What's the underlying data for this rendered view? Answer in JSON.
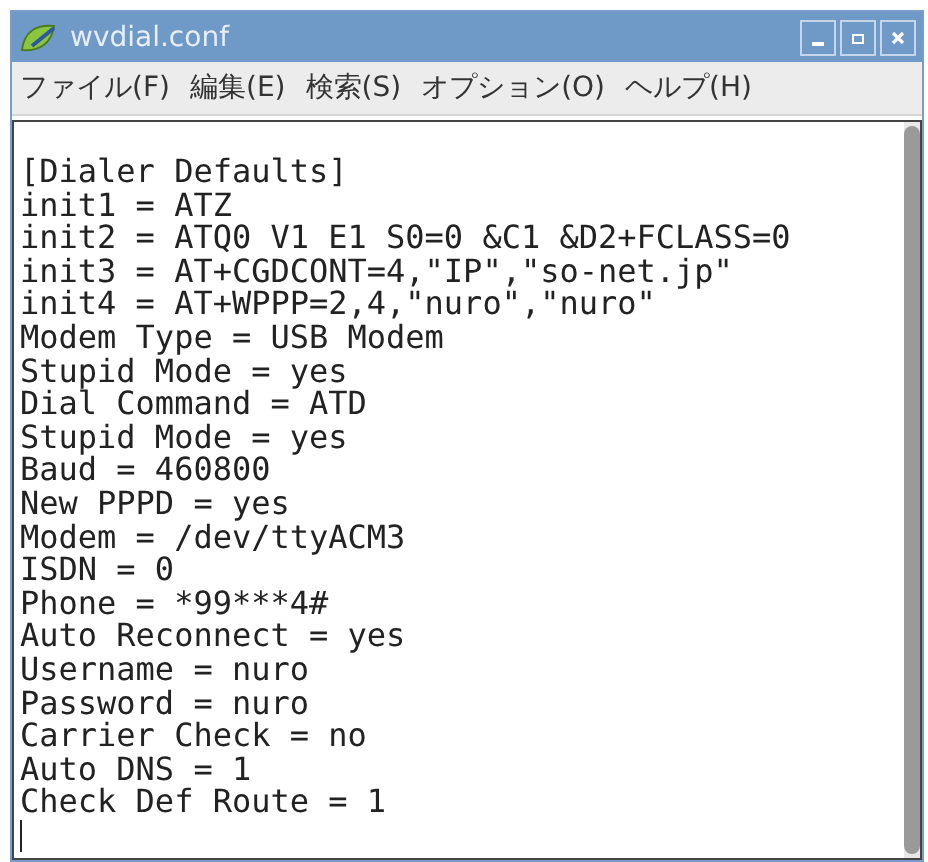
{
  "window": {
    "title": "wvdial.conf"
  },
  "menu": [
    "ファイル(F)",
    "編集(E)",
    "検索(S)",
    "オプション(O)",
    "ヘルプ(H)"
  ],
  "editor": {
    "lines": [
      "[Dialer Defaults]",
      "init1 = ATZ",
      "init2 = ATQ0 V1 E1 S0=0 &C1 &D2+FCLASS=0",
      "init3 = AT+CGDCONT=4,\"IP\",\"so-net.jp\"",
      "init4 = AT+WPPP=2,4,\"nuro\",\"nuro\"",
      "Modem Type = USB Modem",
      "Stupid Mode = yes",
      "Dial Command = ATD",
      "Stupid Mode = yes",
      "Baud = 460800",
      "New PPPD = yes",
      "Modem = /dev/ttyACM3",
      "ISDN = 0",
      "Phone = *99***4#",
      "Auto Reconnect = yes",
      "Username = nuro",
      "Password = nuro",
      "Carrier Check = no",
      "Auto DNS = 1",
      "Check Def Route = 1"
    ]
  }
}
